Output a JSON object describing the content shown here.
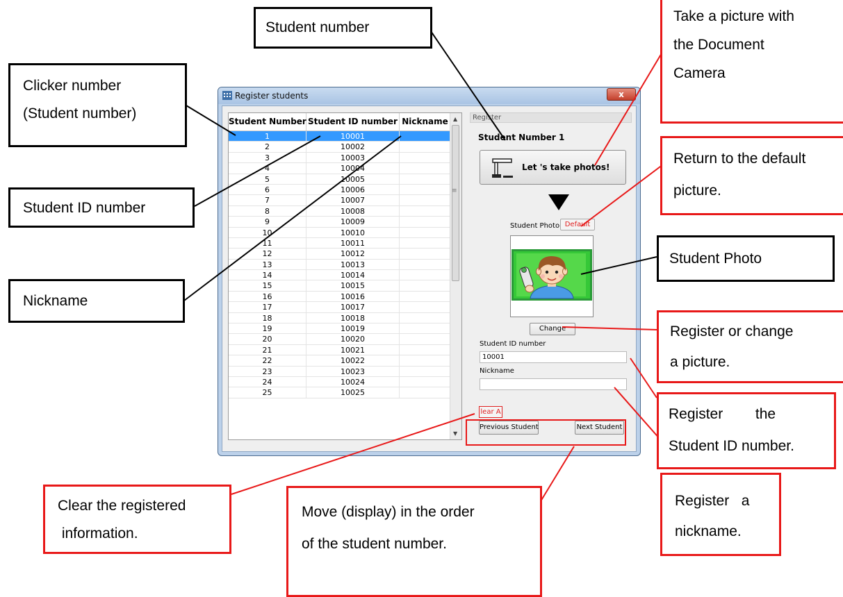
{
  "window": {
    "title": "Register students",
    "close_glyph": "x",
    "grid": {
      "columns": [
        "Student Number",
        "Student ID number",
        "Nickname"
      ],
      "selected_row": 0,
      "rows": [
        {
          "num": "1",
          "id": "10001",
          "nick": ""
        },
        {
          "num": "2",
          "id": "10002",
          "nick": ""
        },
        {
          "num": "3",
          "id": "10003",
          "nick": ""
        },
        {
          "num": "4",
          "id": "10004",
          "nick": ""
        },
        {
          "num": "5",
          "id": "10005",
          "nick": ""
        },
        {
          "num": "6",
          "id": "10006",
          "nick": ""
        },
        {
          "num": "7",
          "id": "10007",
          "nick": ""
        },
        {
          "num": "8",
          "id": "10008",
          "nick": ""
        },
        {
          "num": "9",
          "id": "10009",
          "nick": ""
        },
        {
          "num": "10",
          "id": "10010",
          "nick": ""
        },
        {
          "num": "11",
          "id": "10011",
          "nick": ""
        },
        {
          "num": "12",
          "id": "10012",
          "nick": ""
        },
        {
          "num": "13",
          "id": "10013",
          "nick": ""
        },
        {
          "num": "14",
          "id": "10014",
          "nick": ""
        },
        {
          "num": "15",
          "id": "10015",
          "nick": ""
        },
        {
          "num": "16",
          "id": "10016",
          "nick": ""
        },
        {
          "num": "17",
          "id": "10017",
          "nick": ""
        },
        {
          "num": "18",
          "id": "10018",
          "nick": ""
        },
        {
          "num": "19",
          "id": "10019",
          "nick": ""
        },
        {
          "num": "20",
          "id": "10020",
          "nick": ""
        },
        {
          "num": "21",
          "id": "10021",
          "nick": ""
        },
        {
          "num": "22",
          "id": "10022",
          "nick": ""
        },
        {
          "num": "23",
          "id": "10023",
          "nick": ""
        },
        {
          "num": "24",
          "id": "10024",
          "nick": ""
        },
        {
          "num": "25",
          "id": "10025",
          "nick": ""
        }
      ]
    },
    "panel": {
      "header": "Register",
      "student_number_label": "Student Number 1",
      "photo_button_label": "Let 's take photos!",
      "photo_label": "Student Photo",
      "default_button": "Default",
      "change_button": "Change",
      "id_label": "Student ID number",
      "id_value": "10001",
      "nickname_label": "Nickname",
      "nickname_value": "",
      "clear_button": "lear A",
      "prev_button": "Previous Student",
      "next_button": "Next Student"
    }
  },
  "callouts": {
    "student_number": "Student number",
    "clicker_number": [
      "Clicker number",
      "(Student number)"
    ],
    "student_id": "Student ID number",
    "nickname": "Nickname",
    "take_picture": [
      "Take a picture with",
      "the Document",
      "Camera"
    ],
    "return_default": [
      "Return to the default",
      "picture."
    ],
    "student_photo": "Student Photo",
    "register_change": [
      "Register or change",
      " a picture."
    ],
    "register_id": [
      "Register        the",
      "Student ID number."
    ],
    "clear_info": [
      "Clear the registered",
      " information."
    ],
    "move_display": [
      "Move (display) in the order",
      "of the student number."
    ],
    "register_nick": [
      "Register   a",
      "nickname."
    ]
  },
  "colors": {
    "callout_black": "#000000",
    "callout_red": "#e81818",
    "selection": "#3399ff"
  },
  "icons": {
    "window": "grid-app-icon",
    "camera": "document-camera-icon",
    "arrow": "down-triangle-icon",
    "photo": "student-portrait-icon"
  }
}
